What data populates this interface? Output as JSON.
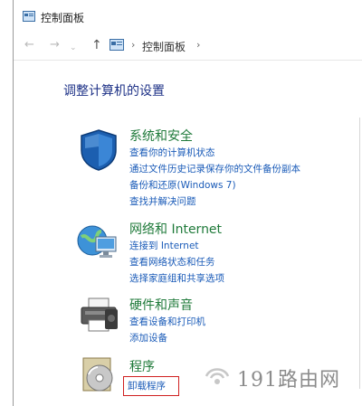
{
  "window": {
    "title": "控制面板"
  },
  "nav": {
    "back_icon": "back-arrow",
    "forward_icon": "forward-arrow",
    "up_icon": "up-arrow",
    "breadcrumb": "控制面板",
    "separator": "›"
  },
  "main": {
    "heading": "调整计算机的设置",
    "categories": [
      {
        "title": "系统和安全",
        "icon": "shield-icon",
        "links": [
          "查看你的计算机状态",
          "通过文件历史记录保存你的文件备份副本",
          "备份和还原(Windows 7)",
          "查找并解决问题"
        ]
      },
      {
        "title": "网络和 Internet",
        "icon": "network-globe-icon",
        "links": [
          "连接到 Internet",
          "查看网络状态和任务",
          "选择家庭组和共享选项"
        ]
      },
      {
        "title": "硬件和声音",
        "icon": "printer-icon",
        "links": [
          "查看设备和打印机",
          "添加设备"
        ]
      },
      {
        "title": "程序",
        "icon": "programs-disc-icon",
        "links": [
          "卸载程序"
        ]
      }
    ]
  },
  "watermark": {
    "text": "191路由网"
  },
  "colors": {
    "heading": "#1e3287",
    "category": "#1f7a3a",
    "link": "#1a5bb8",
    "highlight": "#d02020"
  }
}
